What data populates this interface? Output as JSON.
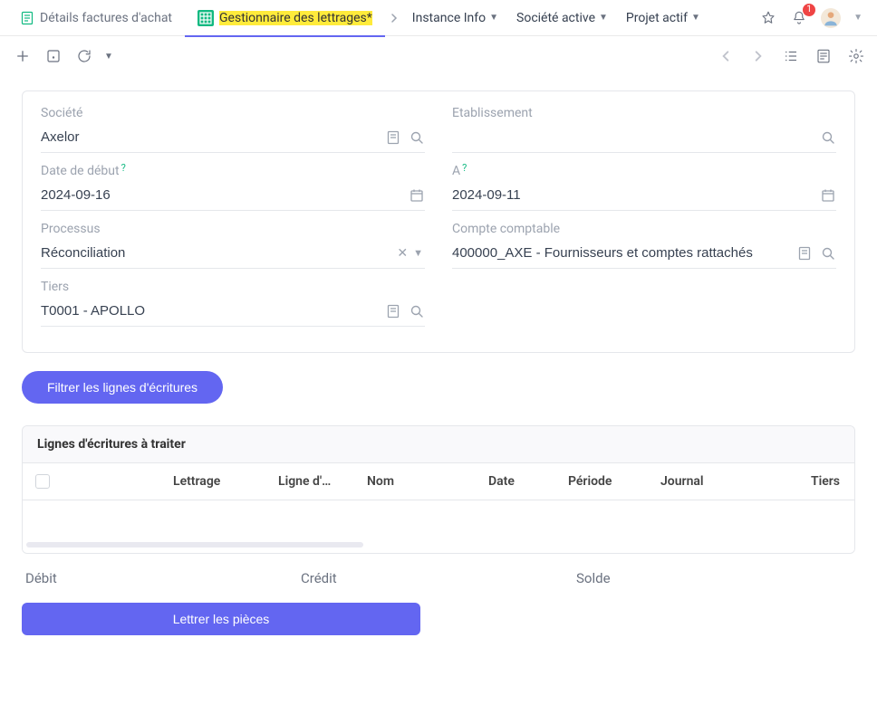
{
  "tabs": {
    "inactive": {
      "label": "Détails factures d'achat"
    },
    "active": {
      "label": "Gestionnaire des lettrages*"
    }
  },
  "menus": {
    "instance": "Instance Info",
    "company": "Société active",
    "project": "Projet actif"
  },
  "notifications": {
    "count": "1"
  },
  "form": {
    "company": {
      "label": "Société",
      "value": "Axelor"
    },
    "establishment": {
      "label": "Etablissement",
      "value": ""
    },
    "date_from": {
      "label": "Date de début",
      "value": "2024-09-16"
    },
    "date_to": {
      "label": "A",
      "value": "2024-09-11"
    },
    "process": {
      "label": "Processus",
      "value": "Réconciliation"
    },
    "account": {
      "label": "Compte comptable",
      "value": "400000_AXE - Fournisseurs et comptes rattachés"
    },
    "partner": {
      "label": "Tiers",
      "value": "T0001 - APOLLO"
    }
  },
  "buttons": {
    "filter": "Filtrer les lignes d'écritures",
    "reconcile": "Lettrer les pièces"
  },
  "table": {
    "title": "Lignes d'écritures à traiter",
    "headers": {
      "lettrage": "Lettrage",
      "ligne": "Ligne d'…",
      "nom": "Nom",
      "date": "Date",
      "periode": "Période",
      "journal": "Journal",
      "tiers": "Tiers"
    }
  },
  "totals": {
    "debit": "Débit",
    "credit": "Crédit",
    "balance": "Solde"
  }
}
